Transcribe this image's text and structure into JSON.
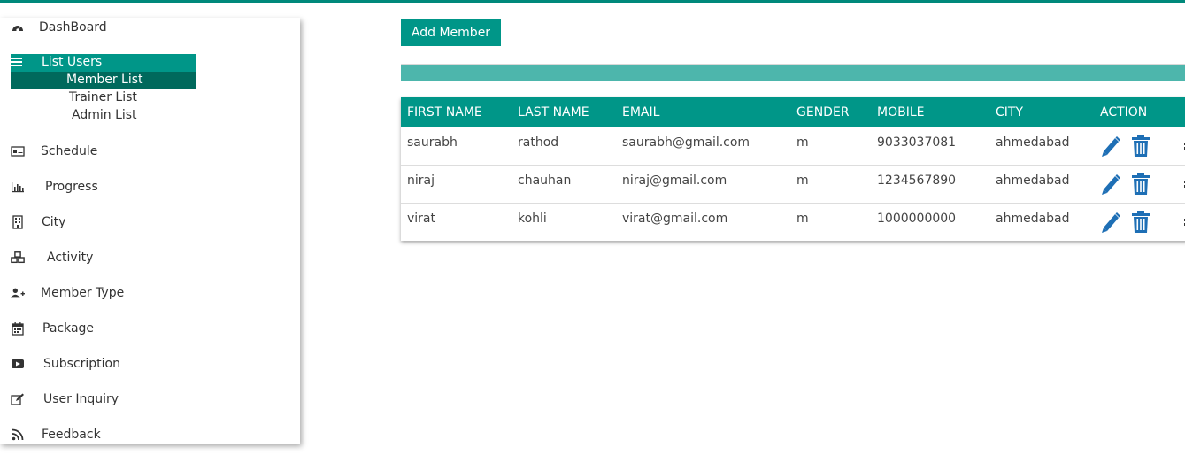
{
  "sidebar": {
    "dashboard": "DashBoard",
    "list_users": "List Users",
    "sub_items": [
      "Member List",
      "Trainer List",
      "Admin List"
    ],
    "items": [
      "Schedule",
      "Progress",
      "City",
      "Activity",
      "Member Type",
      "Package",
      "Subscription",
      "User Inquiry",
      "Feedback"
    ]
  },
  "main": {
    "add_button": "Add Member",
    "progress": 1.0,
    "table": {
      "headers": [
        "FIRST NAME",
        "LAST NAME",
        "EMAIL",
        "GENDER",
        "MOBILE",
        "CITY",
        "ACTION"
      ],
      "rows": [
        [
          "saurabh",
          "rathod",
          "saurabh@gmail.com",
          "m",
          "9033037081",
          "ahmedabad"
        ],
        [
          "niraj",
          "chauhan",
          "niraj@gmail.com",
          "m",
          "1234567890",
          "ahmedabad"
        ],
        [
          "virat",
          "kohli",
          "virat@gmail.com",
          "m",
          "1000000000",
          "ahmedabad"
        ]
      ]
    }
  },
  "colors": {
    "primary": "#009688",
    "primary_dark": "#00695c",
    "progress_fill": "#4db6ac",
    "icon_blue": "#1e6fb5"
  }
}
